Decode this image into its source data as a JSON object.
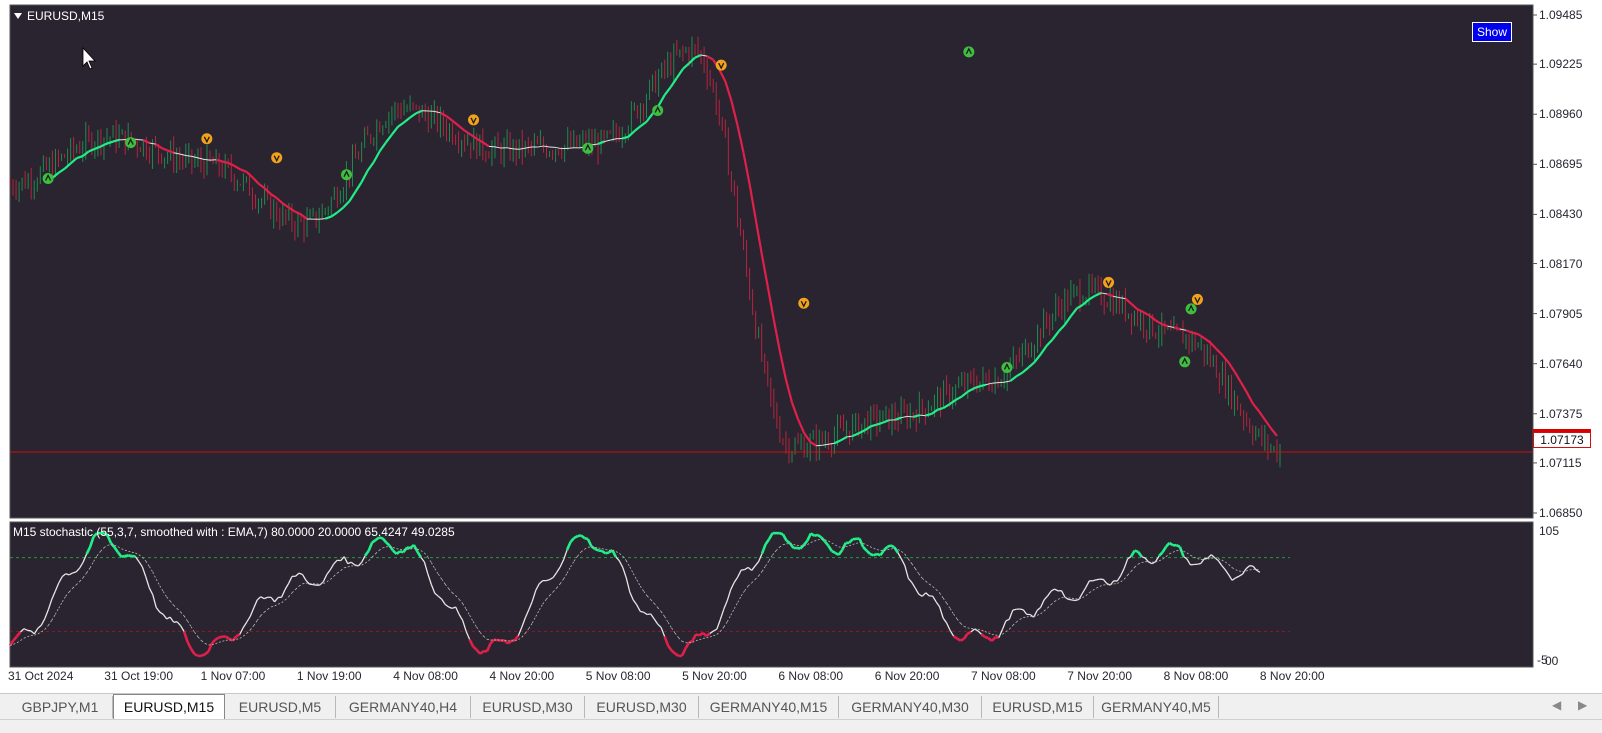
{
  "window": {
    "symbol_title": "EURUSD,M15",
    "show_button_label": "Show"
  },
  "colors": {
    "chart_bg": "#29242f",
    "bull": "#22ee88",
    "bear": "#e0204a",
    "neutral": "#e6e6e6",
    "current_price_line": "#cc1111",
    "level_line": "#1f9a3a",
    "button_bg": "#0000ee"
  },
  "price_axis": {
    "labels": [
      "1.09485",
      "1.09225",
      "1.08960",
      "1.08695",
      "1.08430",
      "1.08170",
      "1.07905",
      "1.07640",
      "1.07375",
      "1.07115",
      "1.06850"
    ],
    "current_price": "1.07173"
  },
  "indicator": {
    "label": "M15 stochastic (55,3,7, smoothed with : EMA,7) 80.0000 20.0000 65.4247 49.0285",
    "axis_top": "105",
    "axis_bottom": "-5",
    "axis_bottom_overlap": "00",
    "overbought": 80,
    "oversold": 20,
    "main_value": 65.4247,
    "signal_value": 49.0285
  },
  "time_axis": {
    "labels": [
      "31 Oct 2024",
      "31 Oct 19:00",
      "1 Nov 07:00",
      "1 Nov 19:00",
      "4 Nov 08:00",
      "4 Nov 20:00",
      "5 Nov 08:00",
      "5 Nov 20:00",
      "6 Nov 08:00",
      "6 Nov 20:00",
      "7 Nov 08:00",
      "7 Nov 20:00",
      "8 Nov 08:00",
      "8 Nov 20:00"
    ]
  },
  "tabs": [
    {
      "label": "GBPJPY,M1",
      "active": false
    },
    {
      "label": "EURUSD,M15",
      "active": true
    },
    {
      "label": "EURUSD,M5",
      "active": false
    },
    {
      "label": "GERMANY40,H4",
      "active": false
    },
    {
      "label": "EURUSD,M30",
      "active": false
    },
    {
      "label": "EURUSD,M30",
      "active": false
    },
    {
      "label": "GERMANY40,M15",
      "active": false
    },
    {
      "label": "GERMANY40,M30",
      "active": false
    },
    {
      "label": "EURUSD,M15",
      "active": false
    },
    {
      "label": "GERMANY40,M5",
      "active": false
    }
  ],
  "tab_nav": {
    "prev": "◀",
    "next": "▶"
  },
  "chart_data": [
    {
      "type": "line",
      "series": [
        {
          "points": [
            [
              "31 Oct 2024",
              1.0859
            ],
            [
              "31 Oct 19:00",
              1.0884
            ],
            [
              "1 Nov 07:00",
              1.087
            ],
            [
              "1 Nov 19:00",
              1.0838
            ],
            [
              "4 Nov 08:00",
              1.0899
            ],
            [
              "4 Nov 20:00",
              1.0877
            ],
            [
              "5 Nov 08:00",
              1.088
            ],
            [
              "5 Nov 20:00",
              1.093
            ],
            [
              "6 Nov 08:00",
              1.072
            ],
            [
              "6 Nov 20:00",
              1.0735
            ],
            [
              "7 Nov 08:00",
              1.0755
            ],
            [
              "7 Nov 20:00",
              1.0802
            ],
            [
              "8 Nov 08:00",
              1.0778
            ],
            [
              "8 Nov 20:00",
              1.0718
            ]
          ]
        }
      ],
      "ylim": [
        1.0685,
        1.09485
      ],
      "current_price": 1.07173,
      "signals_up": [
        1.0862,
        1.0881,
        1.0864,
        1.0878,
        1.0898,
        1.0929,
        1.0762,
        1.0765,
        1.0793
      ],
      "signals_down": [
        1.0883,
        1.0873,
        1.0893,
        1.0922,
        1.0796,
        1.0807,
        1.0798
      ]
    },
    {
      "type": "line",
      "series": [
        {
          "points": [
            [
              "31 Oct 2024",
              10
            ],
            [
              "31 Oct 19:00",
              95
            ],
            [
              "1 Nov 07:00",
              5
            ],
            [
              "1 Nov 19:00",
              60
            ],
            [
              "4 Nov 08:00",
              92
            ],
            [
              "4 Nov 20:00",
              5
            ],
            [
              "5 Nov 08:00",
              95
            ],
            [
              "5 Nov 20:00",
              5
            ],
            [
              "6 Nov 08:00",
              95
            ],
            [
              "6 Nov 20:00",
              88
            ],
            [
              "7 Nov 08:00",
              15
            ],
            [
              "7 Nov 20:00",
              50
            ],
            [
              "8 Nov 08:00",
              85
            ],
            [
              "8 Nov 20:00",
              65
            ]
          ]
        }
      ],
      "ylim": [
        -5,
        105
      ],
      "levels": [
        80,
        20
      ]
    }
  ]
}
